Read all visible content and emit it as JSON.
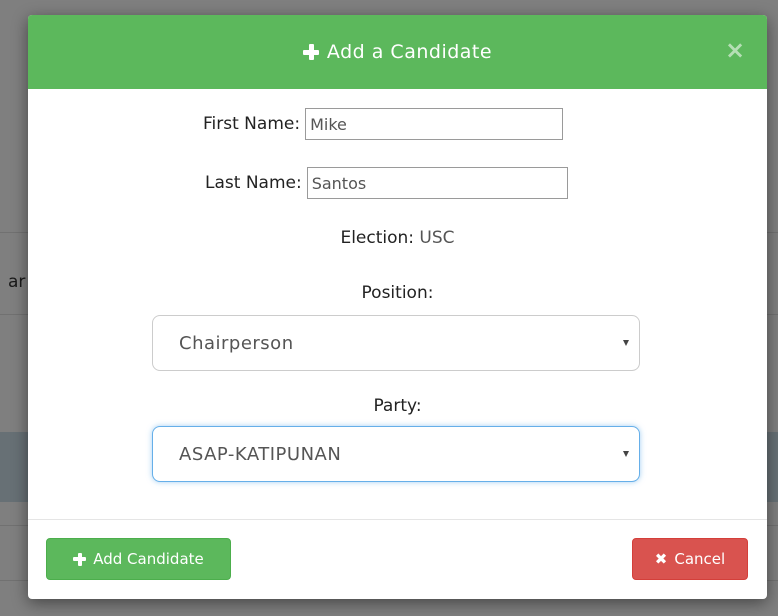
{
  "background": {
    "fragment_text": "ar"
  },
  "modal": {
    "title": "Add a Candidate",
    "close_glyph": "×",
    "header_color": "#5cb85c"
  },
  "form": {
    "first_name": {
      "label": "First Name:",
      "value": "Mike"
    },
    "last_name": {
      "label": "Last Name:",
      "value": "Santos"
    },
    "election": {
      "label": "Election:",
      "value": "USC"
    },
    "position": {
      "label": "Position:",
      "selected": "Chairperson"
    },
    "party": {
      "label": "Party:",
      "selected": "ASAP-KATIPUNAN"
    }
  },
  "footer": {
    "add_label": "Add Candidate",
    "cancel_label": "Cancel",
    "cancel_glyph": "✖",
    "add_color": "#5cb85c",
    "cancel_color": "#d9534f"
  },
  "icons": [
    "plus-icon",
    "close-icon",
    "chevron-down-icon",
    "x-icon"
  ]
}
